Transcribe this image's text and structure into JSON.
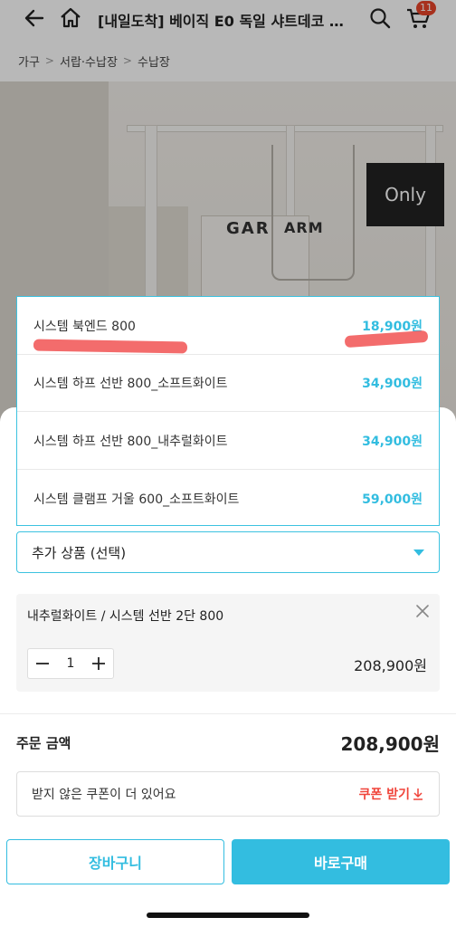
{
  "header": {
    "title": "[내일도착] 베이직 E0 독일 샤트데코 키…",
    "cart_count": "11"
  },
  "breadcrumb": [
    "가구",
    "서랍·수납장",
    "수납장"
  ],
  "photo": {
    "badge": "Only",
    "book_text_1": "GAR",
    "book_text_2": "ARM"
  },
  "options": [
    {
      "name": "시스템 북엔드 800",
      "price": "18,900원"
    },
    {
      "name": "시스템 하프 선반 800_소프트화이트",
      "price": "34,900원"
    },
    {
      "name": "시스템 하프 선반 800_내추럴화이트",
      "price": "34,900원"
    },
    {
      "name": "시스템 클램프 거울 600_소프트화이트",
      "price": "59,000원"
    }
  ],
  "select": {
    "label": "추가 상품 (선택)"
  },
  "selected_item": {
    "name": "내추럴화이트 / 시스템 선반 2단 800",
    "quantity": "1",
    "price": "208,900원"
  },
  "total": {
    "label": "주문 금액",
    "value": "208,900원"
  },
  "coupon": {
    "text": "받지 않은 쿠폰이 더 있어요",
    "link": "쿠폰 받기"
  },
  "buttons": {
    "cart": "장바구니",
    "buy": "바로구매"
  },
  "colors": {
    "accent": "#33bde0",
    "warn": "#f0443a"
  }
}
